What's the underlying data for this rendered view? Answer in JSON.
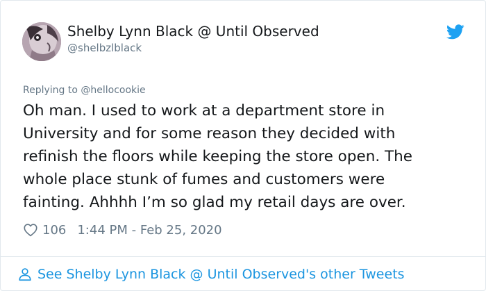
{
  "author": {
    "name": "Shelby Lynn Black @ Until Observed",
    "handle": "@shelbzlblack"
  },
  "reply_context": {
    "prefix": "Replying to",
    "target": "@hellocookie"
  },
  "tweet": {
    "lines": [
      "Oh man.  I used to work at a department store in",
      "University and for some reason they decided with",
      "refinish the floors while keeping the store open.  The",
      "whole place stunk of fumes and customers were",
      "fainting.  Ahhhh I’m so glad my retail days are over."
    ]
  },
  "meta": {
    "likes": "106",
    "timestamp": "1:44 PM - Feb 25, 2020"
  },
  "footer": {
    "link_text": "See Shelby Lynn Black @ Until Observed's other Tweets"
  },
  "icons": {
    "brand": "twitter-bird-icon",
    "like": "heart-icon",
    "profile": "person-icon"
  },
  "colors": {
    "link": "#1b95e0",
    "muted": "#657786",
    "text": "#14171a",
    "border": "#e1e8ed",
    "brand": "#1da1f2"
  }
}
